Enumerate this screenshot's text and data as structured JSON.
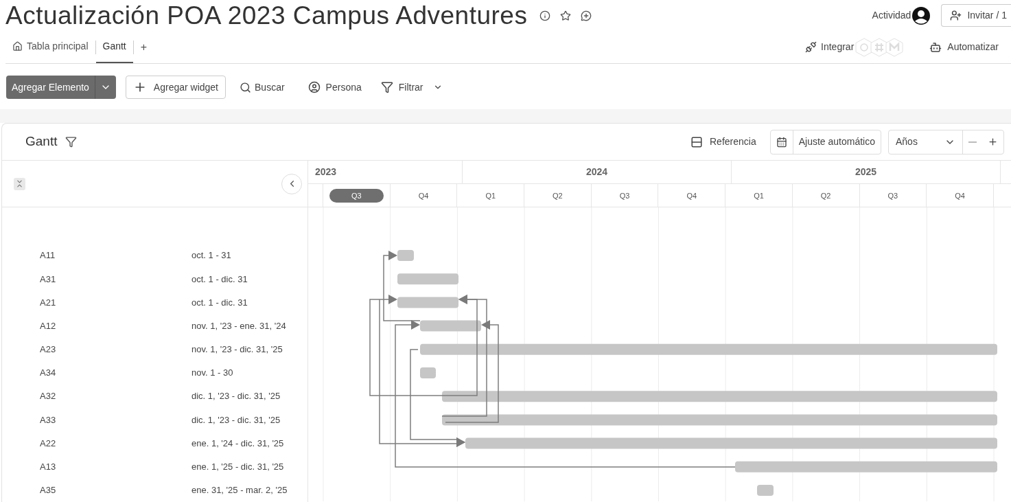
{
  "title": "Actualización POA 2023 Campus Adventures",
  "header": {
    "activity": "Actividad",
    "invite": "Invitar / 1"
  },
  "tabs": [
    {
      "label": "Tabla principal",
      "kind": "home",
      "selected": false
    },
    {
      "label": "Gantt",
      "kind": "plain",
      "selected": true
    }
  ],
  "add_tab": "+",
  "integrate": "Integrar",
  "automate": "Automatizar",
  "toolbar": {
    "add_item": "Agregar Elemento",
    "add_widget": "Agregar widget",
    "search": "Buscar",
    "person": "Persona",
    "filter": "Filtrar"
  },
  "gantt": {
    "title": "Gantt",
    "legend": "Referencia",
    "auto_fit": "Ajuste automático",
    "scale": "Años",
    "years": [
      {
        "label": "2023"
      },
      {
        "label": "2024"
      },
      {
        "label": "2025"
      }
    ],
    "quarters": [
      {
        "label": "Q3",
        "selected": true
      },
      {
        "label": "Q4",
        "selected": false
      },
      {
        "label": "Q1",
        "selected": false
      },
      {
        "label": "Q2",
        "selected": false
      },
      {
        "label": "Q3",
        "selected": false
      },
      {
        "label": "Q4",
        "selected": false
      },
      {
        "label": "Q1",
        "selected": false
      },
      {
        "label": "Q2",
        "selected": false
      },
      {
        "label": "Q3",
        "selected": false
      },
      {
        "label": "Q4",
        "selected": false
      }
    ],
    "items": [
      {
        "name": "A11",
        "dates": "oct. 1 - 31"
      },
      {
        "name": "A31",
        "dates": "oct. 1 - dic. 31"
      },
      {
        "name": "A21",
        "dates": "oct. 1 - dic. 31"
      },
      {
        "name": "A12",
        "dates": "nov. 1, '23 - ene. 31, '24"
      },
      {
        "name": "A23",
        "dates": "nov. 1, '23 - dic. 31, '25"
      },
      {
        "name": "A34",
        "dates": "nov. 1 - 30"
      },
      {
        "name": "A32",
        "dates": "dic. 1, '23 - dic. 31, '25"
      },
      {
        "name": "A33",
        "dates": "dic. 1, '23 - dic. 31, '25"
      },
      {
        "name": "A22",
        "dates": "ene. 1, '24 - dic. 31, '25"
      },
      {
        "name": "A13",
        "dates": "ene. 1, '25 - dic. 31, '25"
      },
      {
        "name": "A35",
        "dates": "ene. 31, '25 - mar. 2, '25"
      }
    ]
  }
}
